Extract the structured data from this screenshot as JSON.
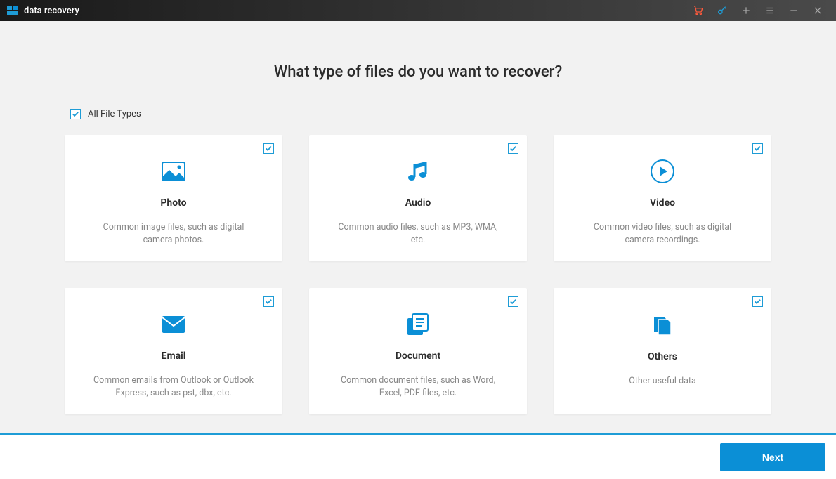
{
  "app": {
    "title": "data recovery"
  },
  "page": {
    "heading": "What type of files do you want to recover?",
    "all_types_label": "All File Types"
  },
  "cards": [
    {
      "title": "Photo",
      "desc": "Common image files, such as digital camera photos.",
      "icon": "image-icon"
    },
    {
      "title": "Audio",
      "desc": "Common audio files, such as MP3, WMA, etc.",
      "icon": "music-icon"
    },
    {
      "title": "Video",
      "desc": "Common video files, such as digital camera recordings.",
      "icon": "play-icon"
    },
    {
      "title": "Email",
      "desc": "Common emails from Outlook or Outlook Express, such as pst, dbx, etc.",
      "icon": "envelope-icon"
    },
    {
      "title": "Document",
      "desc": "Common document files, such as Word, Excel, PDF files, etc.",
      "icon": "document-icon"
    },
    {
      "title": "Others",
      "desc": "Other useful data",
      "icon": "files-icon"
    }
  ],
  "footer": {
    "next_label": "Next"
  },
  "colors": {
    "accent": "#1e9cd6",
    "primary_btn": "#0b8fd6",
    "cart": "#ff5a3c"
  }
}
